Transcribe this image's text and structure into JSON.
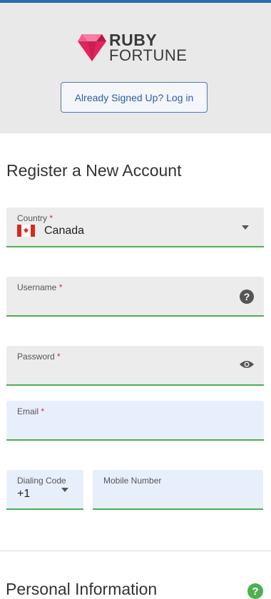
{
  "logo": {
    "line1": "RUBY",
    "line2": "FORTUNE"
  },
  "header": {
    "login_button": "Already Signed Up? Log in"
  },
  "form": {
    "title": "Register a New Account",
    "country": {
      "label": "Country",
      "required_mark": "*",
      "value": "Canada"
    },
    "username": {
      "label": "Username",
      "required_mark": "*",
      "value": ""
    },
    "password": {
      "label": "Password",
      "required_mark": "*",
      "value": ""
    },
    "email": {
      "label": "Email",
      "required_mark": "*",
      "value": ""
    },
    "dialing_code": {
      "label": "Dialing Code",
      "value": "+1"
    },
    "mobile": {
      "label": "Mobile Number",
      "value": ""
    }
  },
  "personal": {
    "title": "Personal Information",
    "help_icon": "?"
  },
  "icons": {
    "help": "?",
    "password_toggle": "eye-icon",
    "dropdown": "chevron-down-icon"
  },
  "colors": {
    "accent": "#4caf50",
    "brand_blue": "#2b5ea7",
    "ruby": "#e0245e"
  }
}
